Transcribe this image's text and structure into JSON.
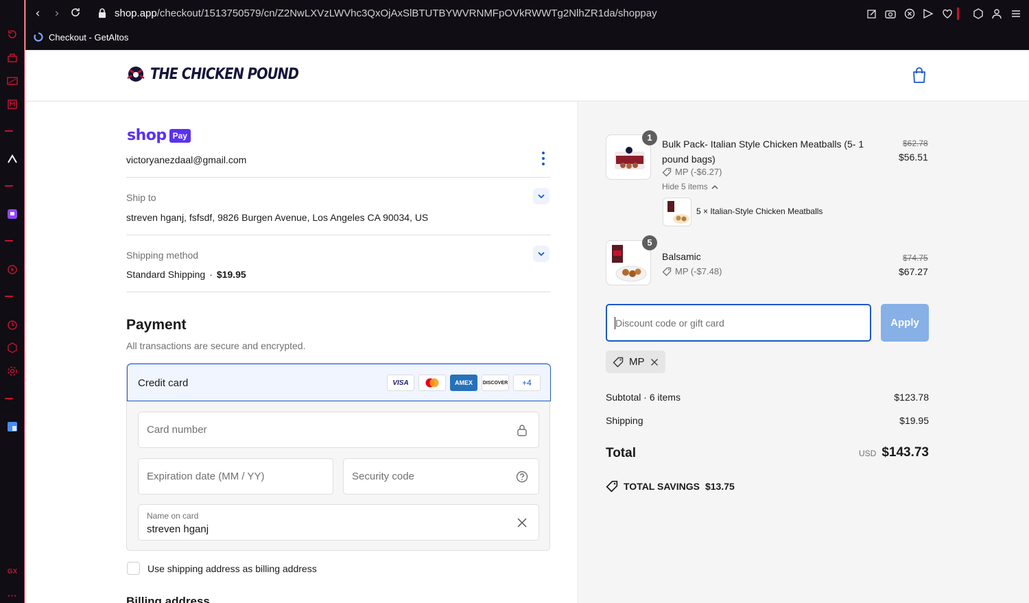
{
  "browser": {
    "url_host": "shop.app",
    "url_path": "/checkout/1513750579/cn/Z2NwLXVzLWVhc3QxOjAxSlBTUTBYWVRNMFpOVkRWWTg2NlhZR1da/shoppay",
    "tab_title": "Checkout - GetAltos",
    "sidebar_label": "GX"
  },
  "store": {
    "name": "THE CHICKEN POUND"
  },
  "account": {
    "shop_brand": "shop",
    "pay_badge": "Pay",
    "email": "victoryanezdaal@gmail.com"
  },
  "ship_to": {
    "label": "Ship to",
    "address": "streven hganj, fsfsdf, 9826 Burgen Avenue, Los Angeles CA 90034, US"
  },
  "shipping_method": {
    "label": "Shipping method",
    "name": "Standard Shipping",
    "separator": "·",
    "price": "$19.95"
  },
  "payment": {
    "title": "Payment",
    "subtitle": "All transactions are secure and encrypted.",
    "method": "Credit card",
    "card_brands": [
      "VISA",
      "MC",
      "AMEX",
      "DISCOVER"
    ],
    "more_brands": "+4",
    "card_number_placeholder": "Card number",
    "expiry_placeholder": "Expiration date (MM / YY)",
    "security_placeholder": "Security code",
    "name_label": "Name on card",
    "name_value": "streven hganj",
    "billing_checkbox_label": "Use shipping address as billing address",
    "billing_checked": false,
    "billing_title": "Billing address"
  },
  "cart": {
    "items": [
      {
        "qty": "1",
        "name": "Bulk Pack- Italian Style Chicken Meatballs (5- 1 pound bags)",
        "discount": "MP (-$6.27)",
        "original_price": "$62.78",
        "price": "$56.51",
        "toggle": "Hide 5 items",
        "sub_item": "5 × Italian-Style Chicken Meatballs"
      },
      {
        "qty": "5",
        "name": "Balsamic",
        "discount": "MP (-$7.48)",
        "original_price": "$74.75",
        "price": "$67.27"
      }
    ],
    "discount_placeholder": "Discount code or gift card",
    "apply_label": "Apply",
    "applied_code": "MP",
    "subtotal_label": "Subtotal · 6 items",
    "subtotal": "$123.78",
    "shipping_label": "Shipping",
    "shipping": "$19.95",
    "total_label": "Total",
    "currency": "USD",
    "total": "$143.73",
    "savings_label": "TOTAL SAVINGS",
    "savings": "$13.75"
  },
  "colors": {
    "accent": "#1a58c7",
    "shop_purple": "#5a31f4",
    "browser_red": "#c4122f"
  }
}
